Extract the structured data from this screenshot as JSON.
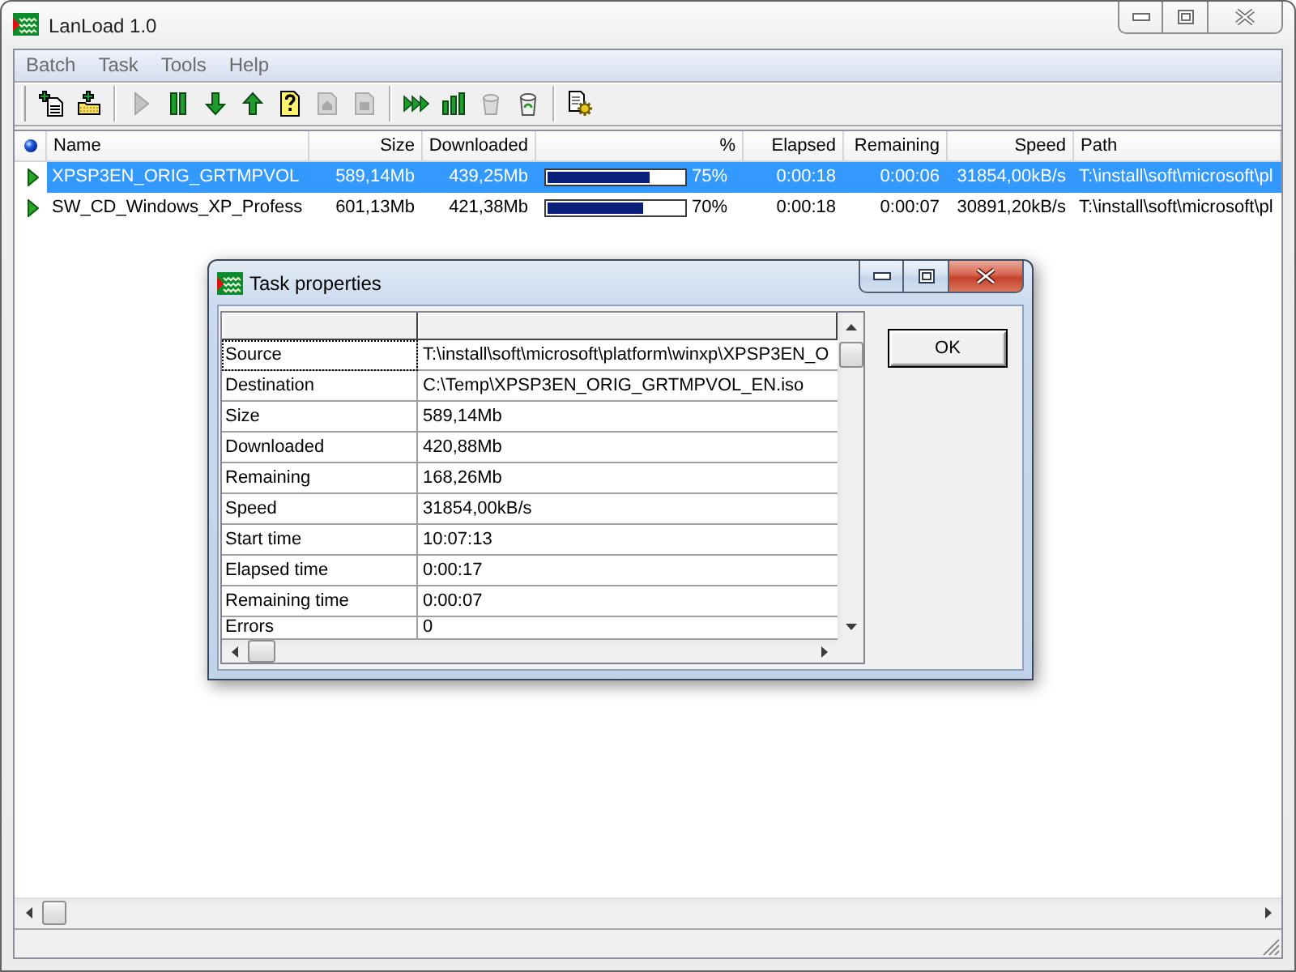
{
  "window": {
    "title": "LanLoad 1.0"
  },
  "menu": [
    {
      "label": "Batch"
    },
    {
      "label": "Task"
    },
    {
      "label": "Tools"
    },
    {
      "label": "Help"
    }
  ],
  "toolbar": [
    {
      "buttons": [
        {
          "disabled": false
        },
        {
          "disabled": false
        }
      ]
    },
    {
      "buttons": [
        {
          "disabled": true
        },
        {
          "disabled": false
        },
        {
          "disabled": false
        },
        {
          "disabled": false
        },
        {
          "disabled": false
        },
        {
          "disabled": true
        },
        {
          "disabled": true
        }
      ]
    },
    {
      "buttons": [
        {
          "disabled": false
        },
        {
          "disabled": false
        },
        {
          "disabled": true
        },
        {
          "disabled": false
        }
      ]
    },
    {
      "buttons": [
        {
          "disabled": false
        }
      ]
    }
  ],
  "task_list": {
    "columns": [
      "Name",
      "Size",
      "Downloaded",
      "%",
      "Elapsed",
      "Remaining",
      "Speed",
      "Path"
    ],
    "rows": [
      {
        "selected": true,
        "name": "XPSP3EN_ORIG_GRTMPVOL",
        "size": "589,14Mb",
        "downloaded": "439,25Mb",
        "level": 0.75,
        "percent": "75%",
        "elapsed": "0:00:18",
        "remaining": "0:00:06",
        "speed": "31854,00kB/s",
        "path": "T:\\install\\soft\\microsoft\\pl"
      },
      {
        "selected": false,
        "name": "SW_CD_Windows_XP_Profess",
        "size": "601,13Mb",
        "downloaded": "421,38Mb",
        "level": 0.7,
        "percent": "70%",
        "elapsed": "0:00:18",
        "remaining": "0:00:07",
        "speed": "30891,20kB/s",
        "path": "T:\\install\\soft\\microsoft\\pl"
      }
    ]
  },
  "dialog": {
    "title": "Task properties",
    "properties": [
      {
        "label": "Source",
        "value": "T:\\install\\soft\\microsoft\\platform\\winxp\\XPSP3EN_O",
        "focused": true
      },
      {
        "label": "Destination",
        "value": "C:\\Temp\\XPSP3EN_ORIG_GRTMPVOL_EN.iso",
        "focused": false
      },
      {
        "label": "Size",
        "value": "589,14Mb",
        "focused": false
      },
      {
        "label": "Downloaded",
        "value": "420,88Mb",
        "focused": false
      },
      {
        "label": "Remaining",
        "value": "168,26Mb",
        "focused": false
      },
      {
        "label": "Speed",
        "value": "31854,00kB/s",
        "focused": false
      },
      {
        "label": "Start time",
        "value": "10:07:13",
        "focused": false
      },
      {
        "label": "Elapsed time",
        "value": "0:00:17",
        "focused": false
      },
      {
        "label": "Remaining time",
        "value": "0:00:07",
        "focused": false
      },
      {
        "label": "Errors",
        "value": "0",
        "focused": false
      }
    ],
    "ok_button": "OK"
  }
}
